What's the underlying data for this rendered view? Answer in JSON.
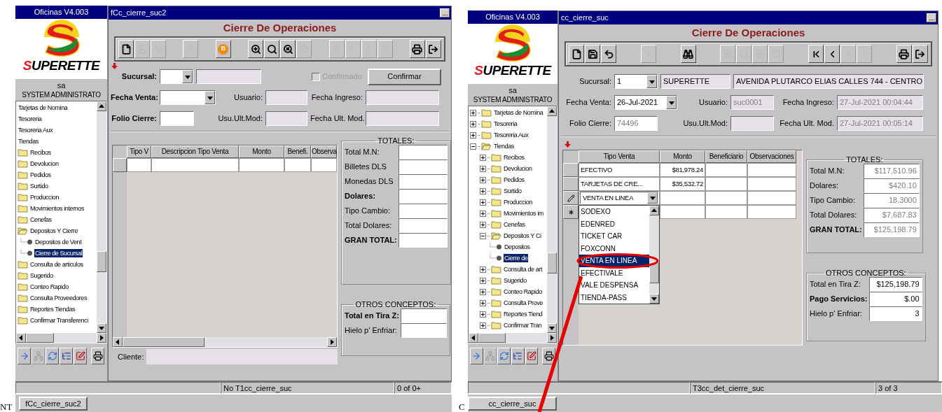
{
  "screens": [
    {
      "sidebar": {
        "title": "Oficinas V4.003",
        "brand": "SUPERETTE",
        "user": "sa",
        "role": "SYSTEM ADMINISTRATO",
        "tree": {
          "scrolled_horizontally": true,
          "items": [
            {
              "label": "Tarjetas de Nomina",
              "kind": "folder",
              "selected": false
            },
            {
              "label": "Tesoreria",
              "kind": "folder",
              "selected": false
            },
            {
              "label": "Tesoreria Aux",
              "kind": "folder",
              "selected": false
            },
            {
              "label": "Tiendas",
              "kind": "folder",
              "expanded": true,
              "selected": false,
              "children": [
                {
                  "label": "Recibos",
                  "kind": "folder",
                  "expanded": false,
                  "selected": false
                },
                {
                  "label": "Devolucion",
                  "kind": "folder",
                  "expanded": false,
                  "selected": false
                },
                {
                  "label": "Pedidos",
                  "kind": "folder",
                  "expanded": false,
                  "selected": false
                },
                {
                  "label": "Surtido",
                  "kind": "folder",
                  "expanded": false,
                  "selected": false
                },
                {
                  "label": "Produccion",
                  "kind": "folder",
                  "expanded": false,
                  "selected": false
                },
                {
                  "label": "Movimientos internos",
                  "kind": "folder",
                  "expanded": false,
                  "selected": false
                },
                {
                  "label": "Cenefas",
                  "kind": "folder",
                  "expanded": false,
                  "selected": false
                },
                {
                  "label": "Depositos Y Cierre",
                  "kind": "folder",
                  "expanded": true,
                  "selected": false,
                  "children": [
                    {
                      "label": "Depositos de Vent",
                      "kind": "leaf",
                      "selected": false
                    },
                    {
                      "label": "Cierre de Sucursal",
                      "kind": "leaf",
                      "selected": true
                    }
                  ]
                },
                {
                  "label": "Consulta de articulos",
                  "kind": "folder",
                  "expanded": false,
                  "selected": false
                },
                {
                  "label": "Sugerido",
                  "kind": "folder",
                  "expanded": false,
                  "selected": false
                },
                {
                  "label": "Conteo Rapido",
                  "kind": "folder",
                  "expanded": false,
                  "selected": false
                },
                {
                  "label": "Consulta Proveedores",
                  "kind": "folder",
                  "expanded": false,
                  "selected": false
                },
                {
                  "label": "Reportes Tiendas",
                  "kind": "folder",
                  "expanded": false,
                  "selected": false
                },
                {
                  "label": "Confirmar Transferenci",
                  "kind": "folder",
                  "expanded": false,
                  "selected": false
                }
              ]
            }
          ]
        },
        "tools": [
          {
            "kind": "go",
            "disabled": false
          },
          {
            "kind": "tree",
            "disabled": true
          },
          {
            "kind": "refresh",
            "disabled": false
          },
          {
            "kind": "list",
            "disabled": false
          },
          {
            "kind": "edit",
            "disabled": false
          },
          {
            "kind": "print",
            "disabled": false
          }
        ]
      },
      "window": {
        "title": "fCc_cierre_suc2",
        "heading": "Cierre De Operaciones",
        "marker": {
          "kind": "header"
        },
        "toolbar": [
          [
            {
              "kind": "new",
              "disabled": false
            },
            {
              "kind": "save",
              "disabled": true
            },
            {
              "kind": "undo",
              "disabled": true
            }
          ],
          [
            {
              "kind": "delete",
              "disabled": true
            }
          ],
          [
            {
              "kind": "badge",
              "label": "B",
              "disabled": false
            }
          ],
          [
            {
              "kind": "query",
              "disabled": false
            },
            {
              "kind": "search",
              "disabled": false
            },
            {
              "kind": "clear",
              "disabled": false
            },
            {
              "kind": "run",
              "disabled": true
            }
          ],
          [
            {
              "kind": "first",
              "disabled": true
            },
            {
              "kind": "prev",
              "disabled": true
            },
            {
              "kind": "next",
              "disabled": true
            },
            {
              "kind": "last",
              "disabled": true
            }
          ],
          [
            {
              "kind": "print",
              "disabled": false
            },
            {
              "kind": "exit",
              "disabled": false
            }
          ]
        ],
        "form_rows": [
          [
            {
              "kind": "label",
              "text": "Sucursal:",
              "bold": true
            },
            {
              "kind": "dropdown"
            },
            {
              "kind": "field",
              "readonly": true
            },
            {
              "kind": "checkbox",
              "label": "Confirmado",
              "checked": false,
              "disabled": true
            },
            {
              "kind": "button",
              "label": "Confirmar"
            }
          ],
          [
            {
              "kind": "label",
              "text": "Fecha Venta:",
              "bold": true
            },
            {
              "kind": "dropdown"
            },
            {
              "kind": "label",
              "text": "Usuario:",
              "bold": false
            },
            {
              "kind": "field",
              "readonly": true
            },
            {
              "kind": "label",
              "text": "Fecha Ingreso:",
              "bold": false
            },
            {
              "kind": "field",
              "readonly": true
            }
          ],
          [
            {
              "kind": "label",
              "text": "Folio Cierre:",
              "bold": true
            },
            {
              "kind": "field",
              "readonly": false
            },
            {
              "kind": "label",
              "text": "Usu.Ult.Mod:",
              "bold": false
            },
            {
              "kind": "field",
              "readonly": true
            },
            {
              "kind": "label",
              "text": "Fecha Ult. Mod.",
              "bold": false
            },
            {
              "kind": "field",
              "readonly": true
            }
          ]
        ],
        "grid": {
          "columns": [
            {
              "label": "Tipo V",
              "kind": "text"
            },
            {
              "label": "Descripcion Tipo Venta",
              "kind": "text"
            },
            {
              "label": "Monto",
              "kind": "amount"
            },
            {
              "label": "Benefi.",
              "kind": "text"
            },
            {
              "label": "Observa",
              "kind": "text"
            }
          ],
          "rows": [
            {
              "kind": "plain"
            }
          ],
          "hscroll": true
        },
        "cliente": {
          "label": "Cliente:"
        },
        "totals": {
          "title": "TOTALES:",
          "rows": [
            {
              "label": "Total M.N:",
              "bold": false
            },
            {
              "label": "Billetes DLS",
              "bold": false
            },
            {
              "label": "Monedas DLS",
              "bold": false
            },
            {
              "label": "Dolares:",
              "bold": true
            },
            {
              "label": "Tipo Cambio:",
              "bold": false
            },
            {
              "label": "Total Dolares:",
              "bold": false
            },
            {
              "label": "GRAN TOTAL:",
              "bold": true
            }
          ]
        },
        "otros": {
          "title": "OTROS CONCEPTOS:",
          "rows": [
            {
              "label": "Total en Tira Z:",
              "bold": true
            },
            {
              "label": "Hielo p' Enfriar:",
              "bold": false
            }
          ]
        },
        "status_bar": {
          "message": "No T1cc_cierre_suc",
          "record": "0 of 0+"
        }
      },
      "taskbar": {
        "edge_text": "NT",
        "tab": "fCc_cierre_suc2"
      }
    },
    {
      "sidebar": {
        "title": "Oficinas V4.003",
        "brand": "SUPERETTE",
        "user": "sa",
        "role": "SYSTEM ADMINISTRATO",
        "tree": {
          "scrolled_horizontally": false,
          "items": [
            {
              "label": "Tarjetas de Nomina",
              "kind": "folder",
              "expanded": false,
              "selected": false
            },
            {
              "label": "Tesoreria",
              "kind": "folder",
              "expanded": false,
              "selected": false
            },
            {
              "label": "Tesoreria Aux",
              "kind": "folder",
              "expanded": false,
              "selected": false
            },
            {
              "label": "Tiendas",
              "kind": "folder",
              "expanded": true,
              "selected": false,
              "children": [
                {
                  "label": "Recibos",
                  "kind": "folder",
                  "expanded": false,
                  "selected": false
                },
                {
                  "label": "Devolucion",
                  "kind": "folder",
                  "expanded": false,
                  "selected": false
                },
                {
                  "label": "Pedidos",
                  "kind": "folder",
                  "expanded": false,
                  "selected": false
                },
                {
                  "label": "Surtido",
                  "kind": "folder",
                  "expanded": false,
                  "selected": false
                },
                {
                  "label": "Produccion",
                  "kind": "folder",
                  "expanded": false,
                  "selected": false
                },
                {
                  "label": "Movimientos im",
                  "kind": "folder",
                  "expanded": false,
                  "selected": false
                },
                {
                  "label": "Cenefas",
                  "kind": "folder",
                  "expanded": false,
                  "selected": false
                },
                {
                  "label": "Depositos Y Ci",
                  "kind": "folder",
                  "expanded": true,
                  "selected": false,
                  "children": [
                    {
                      "label": "Depositos",
                      "kind": "leaf",
                      "selected": false
                    },
                    {
                      "label": "Cierre de",
                      "kind": "leaf",
                      "selected": true
                    }
                  ]
                },
                {
                  "label": "Consulta de art",
                  "kind": "folder",
                  "expanded": false,
                  "selected": false
                },
                {
                  "label": "Sugerido",
                  "kind": "folder",
                  "expanded": false,
                  "selected": false
                },
                {
                  "label": "Conteo Rapido",
                  "kind": "folder",
                  "expanded": false,
                  "selected": false
                },
                {
                  "label": "Consulta Prove",
                  "kind": "folder",
                  "expanded": false,
                  "selected": false
                },
                {
                  "label": "Reportes Tiend",
                  "kind": "folder",
                  "expanded": false,
                  "selected": false
                },
                {
                  "label": "Confirmar Tran",
                  "kind": "folder",
                  "expanded": false,
                  "selected": false
                }
              ]
            }
          ]
        },
        "tools": [
          {
            "kind": "go",
            "disabled": false
          },
          {
            "kind": "tree",
            "disabled": true
          },
          {
            "kind": "refresh",
            "disabled": false
          },
          {
            "kind": "list",
            "disabled": false
          },
          {
            "kind": "edit",
            "disabled": false
          },
          {
            "kind": "print",
            "disabled": false
          }
        ]
      },
      "window": {
        "title": "cc_cierre_suc",
        "heading": "Cierre De Operaciones",
        "marker": {
          "kind": "grid"
        },
        "toolbar": [
          [
            {
              "kind": "new",
              "disabled": false
            },
            {
              "kind": "save",
              "disabled": false
            },
            {
              "kind": "undo",
              "disabled": false
            }
          ],
          [
            {
              "kind": "delete",
              "disabled": true
            }
          ],
          [
            {
              "kind": "binoculars",
              "disabled": false
            }
          ],
          [
            {
              "kind": "query",
              "disabled": true
            },
            {
              "kind": "search",
              "disabled": true
            },
            {
              "kind": "clear",
              "disabled": true
            },
            {
              "kind": "run",
              "disabled": true
            }
          ],
          [
            {
              "kind": "first",
              "disabled": false
            },
            {
              "kind": "prev",
              "disabled": false
            },
            {
              "kind": "next",
              "disabled": true
            },
            {
              "kind": "last",
              "disabled": true
            }
          ],
          [
            {
              "kind": "print",
              "disabled": false
            },
            {
              "kind": "exit",
              "disabled": false
            }
          ]
        ],
        "form_rows": [
          [
            {
              "kind": "label",
              "text": "Sucursal:",
              "bold": false
            },
            {
              "kind": "dropdown",
              "value": "1"
            },
            {
              "kind": "field",
              "readonly": true,
              "value": "SUPERETTE",
              "disabled": false
            },
            {
              "kind": "field",
              "readonly": true,
              "value": "AVENIDA PLUTARCO ELIAS CALLES 744 - CENTRO",
              "disabled": false
            }
          ],
          [
            {
              "kind": "label",
              "text": "Fecha Venta:",
              "bold": false
            },
            {
              "kind": "dropdown",
              "value": "26-Jul-2021"
            },
            {
              "kind": "label",
              "text": "Usuario:",
              "bold": false
            },
            {
              "kind": "field",
              "readonly": true,
              "value": "suc0001",
              "disabled": true
            },
            {
              "kind": "label",
              "text": "Fecha Ingreso:",
              "bold": false
            },
            {
              "kind": "field",
              "readonly": true,
              "value": "27-Jul-2021 00:04:44",
              "disabled": true
            }
          ],
          [
            {
              "kind": "label",
              "text": "Folio Cierre:",
              "bold": false
            },
            {
              "kind": "field",
              "readonly": false,
              "value": "74496",
              "disabled": true
            },
            {
              "kind": "label",
              "text": "Usu.Ult.Mod:",
              "bold": false
            },
            {
              "kind": "field",
              "readonly": true
            },
            {
              "kind": "label",
              "text": "Fecha Ult. Mod.",
              "bold": false
            },
            {
              "kind": "field",
              "readonly": true,
              "value": "27-Jul-2021 00:05:14",
              "disabled": true
            }
          ]
        ],
        "grid": {
          "columns": [
            {
              "label": "Tipo Venta",
              "kind": "text"
            },
            {
              "label": "Monto",
              "kind": "amount"
            },
            {
              "label": "Beneficiario",
              "kind": "text"
            },
            {
              "label": "Observaciones",
              "kind": "text"
            }
          ],
          "rows": [
            {
              "kind": "plain",
              "cells": [
                {
                  "kind": "text",
                  "value": "EFECTIVO"
                },
                {
                  "kind": "text",
                  "value": "$81,978.24"
                }
              ]
            },
            {
              "kind": "plain",
              "cells": [
                {
                  "kind": "text",
                  "value": "TARJETAS DE CRE..."
                },
                {
                  "kind": "text",
                  "value": "$35,532.72"
                }
              ]
            },
            {
              "kind": "edit",
              "cells": [
                {
                  "kind": "dropdown",
                  "value": "VENTA EN LINEA"
                }
              ]
            },
            {
              "kind": "new"
            }
          ],
          "hscroll": false,
          "dropdown_list": {
            "highlighted": true,
            "options": [
              {
                "label": "SODEXO",
                "selected": false
              },
              {
                "label": "EDENRED",
                "selected": false
              },
              {
                "label": "TICKET CAR",
                "selected": false
              },
              {
                "label": "FOXCONN",
                "selected": false
              },
              {
                "label": "VENTA EN LINEA",
                "selected": true
              },
              {
                "label": "EFECTIVALE",
                "selected": false
              },
              {
                "label": "VALE DESPENSA",
                "selected": false
              },
              {
                "label": "TIENDA-PASS",
                "selected": false
              }
            ]
          }
        },
        "totals": {
          "title": "TOTALES:",
          "rows": [
            {
              "label": "Total M.N:",
              "bold": false,
              "value": "$117,510.96",
              "disabled": true
            },
            {
              "label": "Dolares:",
              "bold": false,
              "value": "$420.10",
              "disabled": true
            },
            {
              "label": "Tipo Cambio:",
              "bold": false,
              "value": "18.3000",
              "disabled": true
            },
            {
              "label": "Total Dolares:",
              "bold": false,
              "value": "$7,687.83",
              "disabled": true
            },
            {
              "label": "GRAN TOTAL:",
              "bold": true,
              "value": "$125,198.79",
              "disabled": true
            }
          ]
        },
        "otros": {
          "title": "OTROS CONCEPTOS:",
          "rows": [
            {
              "label": "Total en Tira Z:",
              "bold": false,
              "value": "$125,198.79",
              "disabled": false
            },
            {
              "label": "Pago Servicios:",
              "bold": true,
              "value": "$.00",
              "disabled": false
            },
            {
              "label": "Hielo p' Enfriar:",
              "bold": false,
              "value": "3",
              "disabled": false
            }
          ]
        },
        "status_bar": {
          "message": "T3cc_det_cierre_suc",
          "record": "3 of 3"
        }
      },
      "taskbar": {
        "edge_text": "C",
        "tab": "cc_cierre_suc"
      }
    }
  ]
}
